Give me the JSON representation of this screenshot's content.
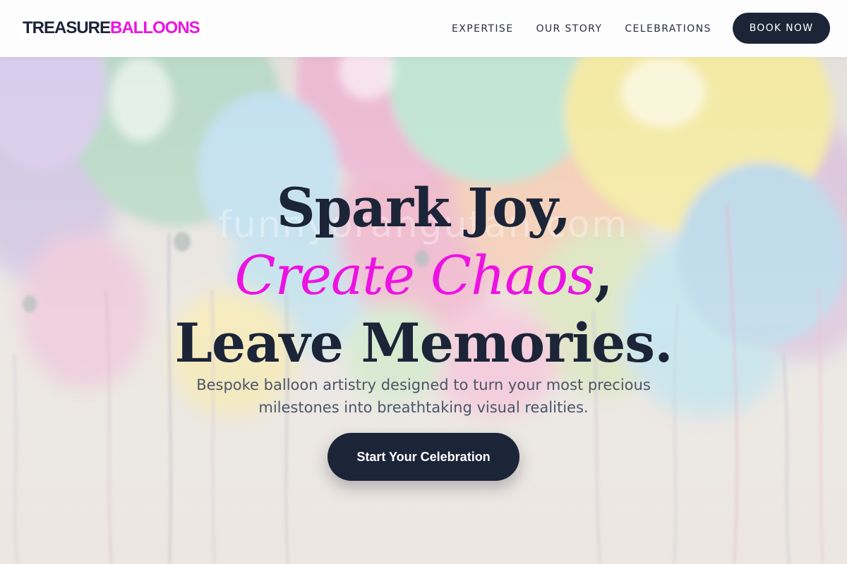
{
  "header": {
    "logo_part1": "TREASURE",
    "logo_part2": "BALLOONS",
    "nav": [
      {
        "label": "EXPERTISE"
      },
      {
        "label": "OUR STORY"
      },
      {
        "label": "CELEBRATIONS"
      }
    ],
    "book_label": "BOOK NOW"
  },
  "hero": {
    "headline_line1": "Spark Joy,",
    "headline_accent": "Create Chaos",
    "headline_comma": ",",
    "headline_line3": "Leave Memories.",
    "subtitle": "Bespoke balloon artistry designed to turn your most precious milestones into breathtaking visual realities.",
    "cta_label": "Start Your Celebration",
    "watermark": "funnyorangutan.com"
  },
  "colors": {
    "navy": "#1c2438",
    "accent_magenta": "#ec13e2",
    "subtitle_gray": "#4b5568"
  }
}
